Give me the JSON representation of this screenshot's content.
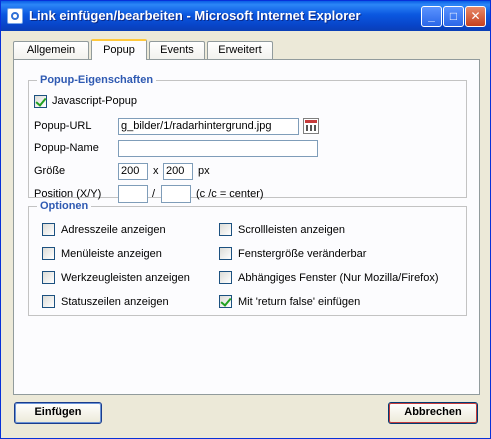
{
  "window": {
    "title": "Link einfügen/bearbeiten - Microsoft Internet Explorer",
    "minimize_glyph": "_",
    "maximize_glyph": "□",
    "close_glyph": "✕"
  },
  "tabs": [
    {
      "label": "Allgemein"
    },
    {
      "label": "Popup"
    },
    {
      "label": "Events"
    },
    {
      "label": "Erweitert"
    }
  ],
  "popup_section": {
    "legend": "Popup-Eigenschaften",
    "javascript_popup_label": "Javascript-Popup",
    "javascript_popup_checked": true,
    "url_label": "Popup-URL",
    "url_value": "g_bilder/1/radarhintergrund.jpg",
    "name_label": "Popup-Name",
    "name_value": "",
    "size_label": "Größe",
    "width_value": "200",
    "size_separator": "x",
    "height_value": "200",
    "size_unit": "px",
    "position_label": "Position (X/Y)",
    "pos_x_value": "",
    "pos_separator": "/",
    "pos_y_value": "",
    "position_hint": "(c /c = center)"
  },
  "options_section": {
    "legend": "Optionen",
    "items": [
      {
        "label": "Adresszeile anzeigen",
        "checked": false
      },
      {
        "label": "Scrollleisten anzeigen",
        "checked": false
      },
      {
        "label": "Menüleiste anzeigen",
        "checked": false
      },
      {
        "label": "Fenstergröße veränderbar",
        "checked": false
      },
      {
        "label": "Werkzeugleisten anzeigen",
        "checked": false
      },
      {
        "label": "Abhängiges Fenster (Nur Mozilla/Firefox)",
        "checked": false
      },
      {
        "label": "Statuszeilen anzeigen",
        "checked": false
      },
      {
        "label": "Mit 'return false' einfügen",
        "checked": true
      }
    ]
  },
  "buttons": {
    "insert_label": "Einfügen",
    "cancel_label": "Abbrechen"
  },
  "colors": {
    "titlebar": "#0a5fe6",
    "legend_text": "#2f5ab2",
    "active_tab_accent": "#ffc83c"
  }
}
